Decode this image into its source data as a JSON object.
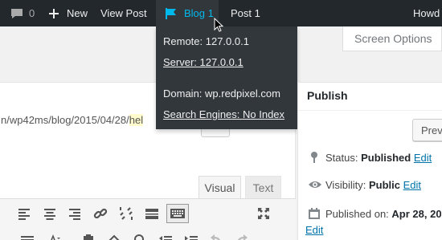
{
  "adminbar": {
    "comments_count": "0",
    "new_label": "New",
    "view_post_label": "View Post",
    "blog_label": "Blog 1",
    "post_label": "Post 1",
    "howdy_label": "Howd"
  },
  "dropdown": {
    "remote": "Remote: 127.0.0.1",
    "server": "Server: 127.0.0.1",
    "domain": "Domain: wp.redpixel.com",
    "search_engines": "Search Engines: No Index"
  },
  "screen_options_label": "Screen Options",
  "editor": {
    "permalink_prefix": "n/wp42ms/blog/2015/04/28/",
    "permalink_slug": "hel",
    "tabs": [
      "Visual",
      "Text"
    ]
  },
  "publish": {
    "title": "Publish",
    "preview_label": "Prev",
    "status_label": "Status:",
    "status_value": "Published",
    "visibility_label": "Visibility:",
    "visibility_value": "Public",
    "published_on_label": "Published on:",
    "published_on_value": "Apr 28, 20",
    "edit_label": "Edit"
  },
  "colors": {
    "adminbar_bg": "#23282d",
    "dropdown_bg": "#32373c",
    "accent": "#00b9eb",
    "link": "#0073aa"
  }
}
